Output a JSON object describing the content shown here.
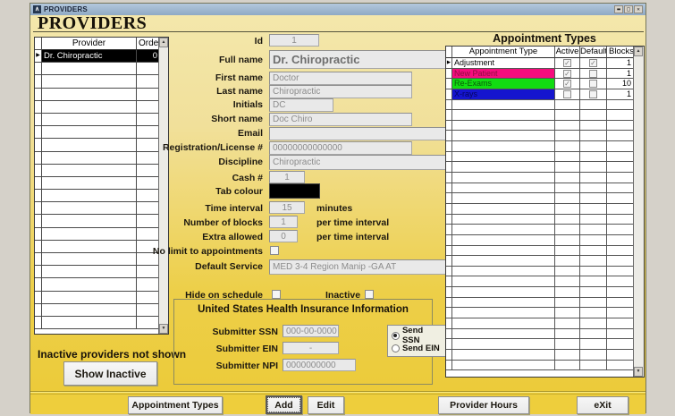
{
  "window": {
    "title": "PROVIDERS"
  },
  "heading": "PROVIDERS",
  "provider_list": {
    "columns": {
      "provider": "Provider",
      "order": "Order"
    },
    "rows": [
      {
        "provider": "Dr. Chiropractic",
        "order": "0",
        "selected": true
      }
    ],
    "empty_rows": 21
  },
  "inactive_note": "Inactive providers not shown",
  "form": {
    "id": {
      "label": "Id",
      "value": "1"
    },
    "full_name": {
      "label": "Full name",
      "value": "Dr. Chiropractic"
    },
    "first_name": {
      "label": "First name",
      "value": "Doctor"
    },
    "last_name": {
      "label": "Last name",
      "value": "Chiropractic"
    },
    "initials": {
      "label": "Initials",
      "value": "DC"
    },
    "short_name": {
      "label": "Short name",
      "value": "Doc Chiro"
    },
    "email": {
      "label": "Email",
      "value": ""
    },
    "registration": {
      "label": "Registration/License #",
      "value": "00000000000000"
    },
    "discipline": {
      "label": "Discipline",
      "value": "Chiropractic"
    },
    "cash": {
      "label": "Cash #",
      "value": "1"
    },
    "tab_colour": {
      "label": "Tab colour",
      "swatch": "#000000"
    },
    "time_interval": {
      "label": "Time interval",
      "value": "15",
      "suffix": "minutes"
    },
    "number_of_blocks": {
      "label": "Number of blocks",
      "value": "1",
      "suffix": "per time interval"
    },
    "extra_allowed": {
      "label": "Extra allowed",
      "value": "0",
      "suffix": "per time interval"
    },
    "no_limit": {
      "label": "No limit to appointments",
      "checked": false
    },
    "default_service": {
      "label": "Default Service",
      "value": "MED 3-4 Region Manip -GA  AT"
    },
    "hide_on_schedule": {
      "label": "Hide on schedule",
      "checked": false
    },
    "inactive": {
      "label": "Inactive",
      "checked": false
    }
  },
  "us_insurance": {
    "title": "United States Health Insurance Information",
    "submitter_ssn": {
      "label": "Submitter SSN",
      "value": "000-00-0000"
    },
    "submitter_ein": {
      "label": "Submitter EIN",
      "value": "-"
    },
    "submitter_npi": {
      "label": "Submitter NPI",
      "value": "0000000000"
    },
    "send_options": [
      {
        "label": "Send SSN",
        "selected": true
      },
      {
        "label": "Send EIN",
        "selected": false
      }
    ]
  },
  "appointment_types": {
    "title": "Appointment Types",
    "columns": {
      "type": "Appointment Type",
      "active": "Active",
      "default": "Default",
      "blocks": "Blocks"
    },
    "rows": [
      {
        "type": "Adjustment",
        "active": true,
        "default": true,
        "blocks": "1",
        "bg": "#FFFFFF",
        "fg": "#000000",
        "selected": true
      },
      {
        "type": "New Patient",
        "active": true,
        "default": false,
        "blocks": "1",
        "bg": "#F60D7E",
        "fg": "#8F1040",
        "selected": false
      },
      {
        "type": "Re-Exams",
        "active": true,
        "default": false,
        "blocks": "10",
        "bg": "#12DC12",
        "fg": "#0A5A0A",
        "selected": false
      },
      {
        "type": "X-rays",
        "active": false,
        "default": false,
        "blocks": "1",
        "bg": "#1515CE",
        "fg": "#05055E",
        "selected": false
      }
    ],
    "empty_rows": 26
  },
  "buttons": {
    "show_inactive": "Show Inactive",
    "appointment_types": "Appointment Types",
    "add": "Add",
    "edit": "Edit",
    "provider_hours": "Provider Hours",
    "exit": "eXit"
  },
  "colors": {
    "accent_pink": "#F60D7E",
    "accent_green": "#12DC12",
    "accent_blue": "#1515CE",
    "tab_colour": "#000000"
  }
}
